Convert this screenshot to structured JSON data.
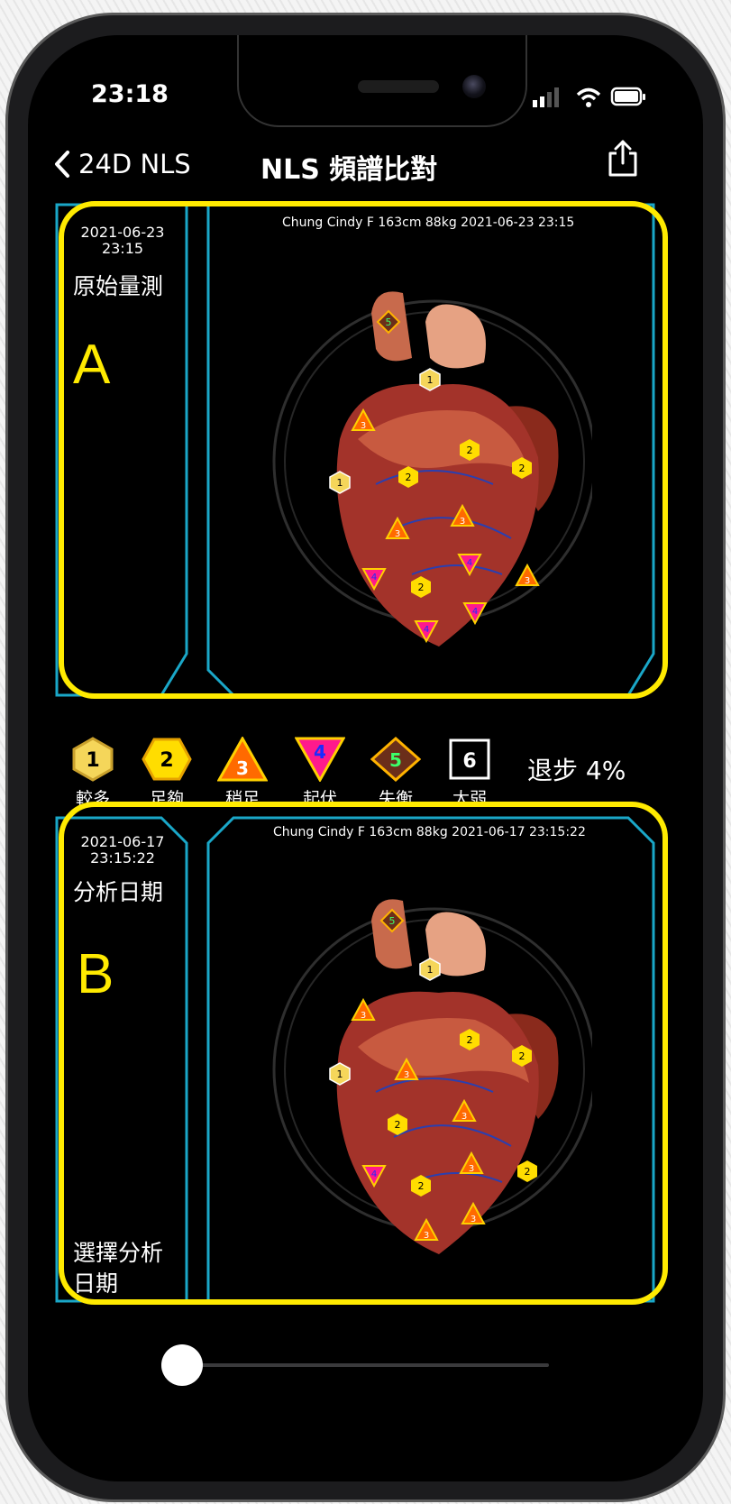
{
  "status_bar": {
    "time": "23:18"
  },
  "nav": {
    "back_label": "24D NLS",
    "title": "NLS 頻譜比對"
  },
  "panel_a": {
    "letter": "A",
    "date": "2021-06-23",
    "time": "23:15",
    "label": "原始量測",
    "caption": "Chung Cindy  F  163cm  88kg   2021-06-23 23:15"
  },
  "panel_b": {
    "letter": "B",
    "date": "2021-06-17",
    "time": "23:15:22",
    "label": "分析日期",
    "select_label": "選擇分析日期",
    "caption": "Chung Cindy  F  163cm  88kg   2021-06-17 23:15:22"
  },
  "legend": {
    "items": [
      {
        "num": "1",
        "label": "較多",
        "shape": "hexagon",
        "color": "#f5d65a"
      },
      {
        "num": "2",
        "label": "足夠",
        "shape": "hexagon",
        "color": "#ffdd00"
      },
      {
        "num": "3",
        "label": "稍足",
        "shape": "triangle",
        "color": "#ff6a00"
      },
      {
        "num": "4",
        "label": "起伏",
        "shape": "triangle-down",
        "color": "#ff1a8c"
      },
      {
        "num": "5",
        "label": "失衡",
        "shape": "diamond",
        "color": "#6b2e1a"
      },
      {
        "num": "6",
        "label": "太弱",
        "shape": "square",
        "color": "#000000"
      }
    ],
    "recede": "退步 4%"
  },
  "colors": {
    "accent": "#ffea00",
    "frame": "#1aa7c8",
    "background": "#000000"
  }
}
